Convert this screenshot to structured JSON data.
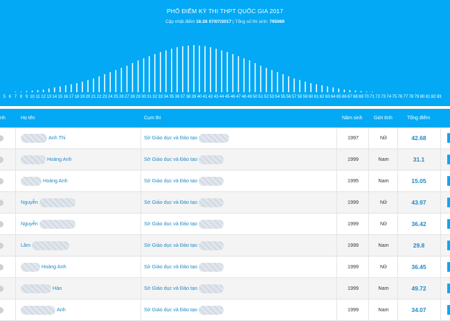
{
  "page": {
    "title": "PHỔ ĐIỂM KỲ THI THPT QUỐC GIA 2017",
    "updated_label": "Cập nhật điểm",
    "updated_time": "16:26 07/07/2017",
    "separator": "|",
    "total_label": "Tổng số thí sinh:",
    "total_count": "795069"
  },
  "chart_data": {
    "type": "bar",
    "title": "PHỔ ĐIỂM KỲ THI THPT QUỐC GIA 2017",
    "categories": [
      "5",
      "6",
      "7",
      "8",
      "9",
      "10",
      "11",
      "12",
      "13",
      "14",
      "15",
      "16",
      "17",
      "18",
      "19",
      "20",
      "21",
      "22",
      "23",
      "24",
      "25",
      "26",
      "27",
      "28",
      "29",
      "30",
      "31",
      "32",
      "33",
      "34",
      "35",
      "36",
      "37",
      "38",
      "39",
      "40",
      "41",
      "42",
      "43",
      "44",
      "45",
      "46",
      "47",
      "48",
      "49",
      "50",
      "51",
      "52",
      "53",
      "54",
      "55",
      "56",
      "57",
      "58",
      "59",
      "60",
      "61",
      "62",
      "63",
      "64",
      "65",
      "66",
      "67",
      "68",
      "69",
      "70",
      "71",
      "72",
      "73",
      "74",
      "75",
      "76",
      "77",
      "78",
      "79",
      "80",
      "81",
      "82",
      "83"
    ],
    "values": [
      0,
      0,
      1,
      1,
      2,
      3,
      4,
      5,
      7,
      9,
      11,
      13,
      15,
      17,
      20,
      23,
      26,
      30,
      34,
      38,
      42,
      46,
      50,
      55,
      60,
      64,
      68,
      72,
      76,
      79,
      82,
      85,
      87,
      88,
      89,
      88,
      87,
      85,
      82,
      79,
      76,
      72,
      68,
      64,
      60,
      55,
      50,
      46,
      42,
      38,
      34,
      30,
      26,
      23,
      20,
      17,
      15,
      13,
      11,
      9,
      7,
      5,
      4,
      3,
      2,
      1,
      1,
      0,
      0,
      0,
      0,
      0,
      0,
      0,
      0,
      0,
      0,
      0,
      0
    ],
    "ylim": [
      0,
      100
    ],
    "grid": false,
    "legend": "none"
  },
  "table": {
    "headers": {
      "col0": "nh",
      "name": "Họ tên",
      "cluster": "Cụm thi",
      "year": "Năm sinh",
      "gender": "Giới tính",
      "score": "Tổng điểm"
    },
    "rows": [
      {
        "name": "Anh Thi",
        "cluster": "Sở Giáo dục và Đào tạo",
        "year": "1997",
        "gender": "Nữ",
        "score": "42.68"
      },
      {
        "name": "Hoàng Anh",
        "cluster": "Sở Giáo dục và Đào tạo",
        "year": "1999",
        "gender": "Nam",
        "score": "31.1"
      },
      {
        "name": "Hoàng Anh",
        "cluster": "Sở Giáo dục và Đào tạo",
        "year": "1995",
        "gender": "Nam",
        "score": "15.05"
      },
      {
        "name": "Nguyễn",
        "cluster": "Sở Giáo dục và Đào tạo",
        "year": "1999",
        "gender": "Nữ",
        "score": "43.97"
      },
      {
        "name": "Nguyễn",
        "cluster": "Sở Giáo dục và Đào tạo",
        "year": "1999",
        "gender": "Nữ",
        "score": "36.42"
      },
      {
        "name": "Lâm",
        "cluster": "Sở Giáo dục và Đào tạo",
        "year": "1999",
        "gender": "Nam",
        "score": "29.8"
      },
      {
        "name": "Hoàng Anh",
        "cluster": "Sở Giáo dục và Đào tạo",
        "year": "1999",
        "gender": "Nữ",
        "score": "36.45"
      },
      {
        "name": "Hào",
        "cluster": "Sở Giáo dục và Đào tạo",
        "year": "1999",
        "gender": "Nam",
        "score": "49.72"
      },
      {
        "name": "Anh",
        "cluster": "Sở Giáo dục và Đào tạo",
        "year": "1999",
        "gender": "Nam",
        "score": "34.07"
      }
    ]
  }
}
